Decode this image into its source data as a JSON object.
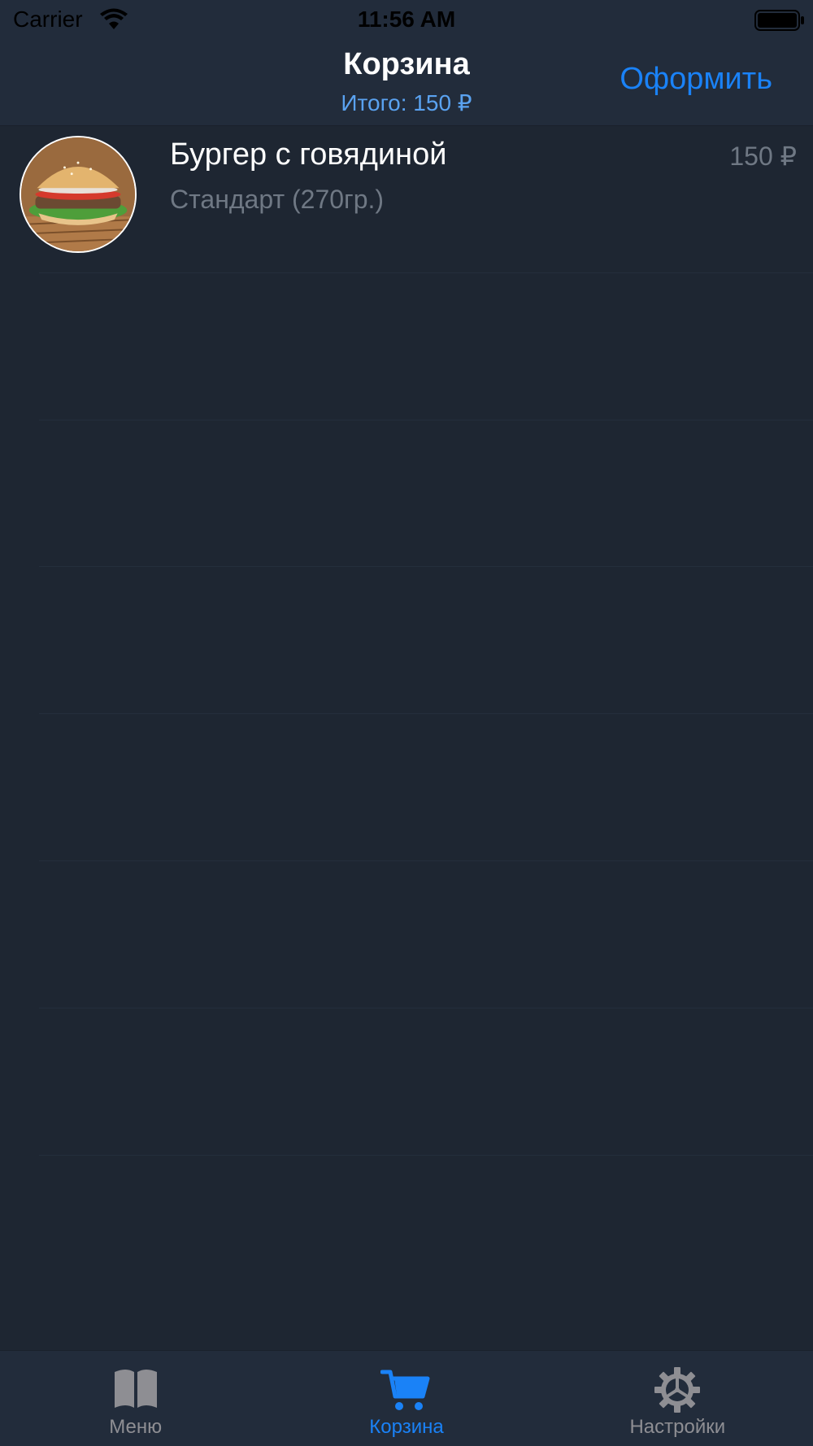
{
  "status_bar": {
    "carrier": "Carrier",
    "time": "11:56 AM"
  },
  "nav": {
    "title": "Корзина",
    "subtitle": "Итого: 150 ₽",
    "checkout_label": "Оформить"
  },
  "cart": {
    "items": [
      {
        "name": "Бургер с говядиной",
        "variant": "Стандарт (270гр.)",
        "price": "150 ₽",
        "thumbnail_icon": "burger-photo"
      }
    ]
  },
  "tab_bar": {
    "tabs": [
      {
        "label": "Меню",
        "icon": "book-icon",
        "active": false
      },
      {
        "label": "Корзина",
        "icon": "cart-icon",
        "active": true
      },
      {
        "label": "Настройки",
        "icon": "gear-icon",
        "active": false
      }
    ]
  },
  "colors": {
    "background": "#1e2632",
    "bars": "#222c3b",
    "accent": "#1a82f7",
    "subtitle": "#5aa2f0",
    "secondary_text": "#6f7884",
    "inactive_tab": "#8e8e93"
  }
}
